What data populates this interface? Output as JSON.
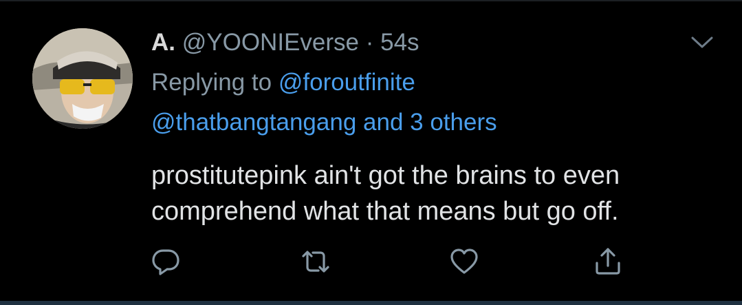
{
  "tweet": {
    "display_name": "A.",
    "handle": "@YOONIEverse",
    "separator": "·",
    "time": "54s",
    "replying_prefix": "Replying to",
    "replying_primary": "@foroutfinite",
    "replying_secondary": "@thatbangtangang and 3 others",
    "text_lines": [
      "prostitutepink ain't got the brains to even",
      "comprehend what that means but go off."
    ]
  },
  "actions": {
    "reply_icon": "reply-icon",
    "retweet_icon": "retweet-icon",
    "like_icon": "heart-icon",
    "share_icon": "share-icon"
  },
  "colors": {
    "background": "#000000",
    "primary_text": "#d9d9d9",
    "secondary_text": "#8899a6",
    "link": "#4a9eec",
    "icon": "#8899a6"
  }
}
